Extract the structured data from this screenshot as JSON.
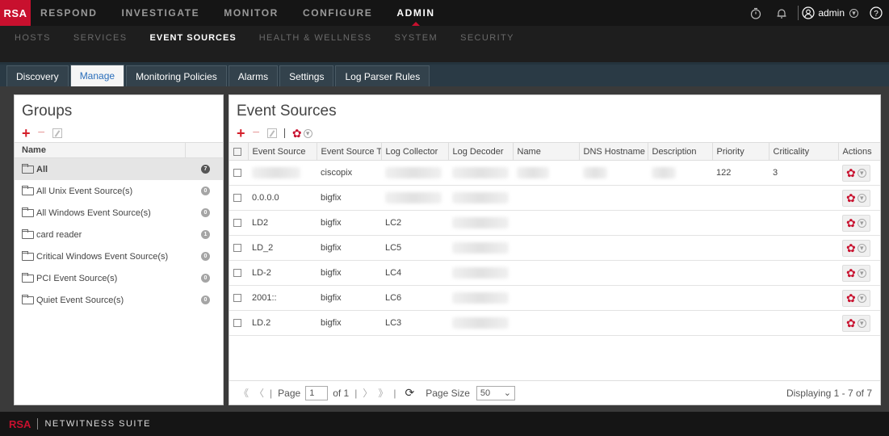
{
  "brand": {
    "logo": "RSA",
    "footer_logo": "RSA",
    "footer_suite": "NETWITNESS SUITE"
  },
  "topnav": {
    "items": [
      "RESPOND",
      "INVESTIGATE",
      "MONITOR",
      "CONFIGURE",
      "ADMIN"
    ],
    "user": "admin"
  },
  "subnav": {
    "items": [
      "HOSTS",
      "SERVICES",
      "EVENT SOURCES",
      "HEALTH & WELLNESS",
      "SYSTEM",
      "SECURITY"
    ]
  },
  "tabs": [
    "Discovery",
    "Manage",
    "Monitoring Policies",
    "Alarms",
    "Settings",
    "Log Parser Rules"
  ],
  "groups": {
    "title": "Groups",
    "column_name": "Name",
    "items": [
      {
        "label": "All",
        "count": "7"
      },
      {
        "label": "All Unix Event Source(s)",
        "count": "0"
      },
      {
        "label": "All Windows Event Source(s)",
        "count": "0"
      },
      {
        "label": "card reader",
        "count": "1"
      },
      {
        "label": "Critical Windows Event Source(s)",
        "count": "0"
      },
      {
        "label": "PCI Event Source(s)",
        "count": "0"
      },
      {
        "label": "Quiet Event Source(s)",
        "count": "0"
      }
    ]
  },
  "events": {
    "title": "Event Sources",
    "columns": [
      "Event Source",
      "Event Source Ty",
      "Log Collector",
      "Log Decoder",
      "Name",
      "DNS Hostname",
      "Description",
      "Priority",
      "Criticality",
      "Actions"
    ],
    "rows": [
      {
        "source": "",
        "type": "ciscopix",
        "collector": "",
        "decoder": "",
        "name": "",
        "dns": "",
        "desc": "",
        "priority": "122",
        "criticality": "3"
      },
      {
        "source": "0.0.0.0",
        "type": "bigfix",
        "collector": "",
        "decoder": "",
        "name": "",
        "dns": "",
        "desc": "",
        "priority": "",
        "criticality": ""
      },
      {
        "source": "LD2",
        "type": "bigfix",
        "collector": "LC2",
        "decoder": "",
        "name": "",
        "dns": "",
        "desc": "",
        "priority": "",
        "criticality": ""
      },
      {
        "source": "LD_2",
        "type": "bigfix",
        "collector": "LC5",
        "decoder": "",
        "name": "",
        "dns": "",
        "desc": "",
        "priority": "",
        "criticality": ""
      },
      {
        "source": "LD-2",
        "type": "bigfix",
        "collector": "LC4",
        "decoder": "",
        "name": "",
        "dns": "",
        "desc": "",
        "priority": "",
        "criticality": ""
      },
      {
        "source": "2001::",
        "type": "bigfix",
        "collector": "LC6",
        "decoder": "",
        "name": "",
        "dns": "",
        "desc": "",
        "priority": "",
        "criticality": ""
      },
      {
        "source": "LD.2",
        "type": "bigfix",
        "collector": "LC3",
        "decoder": "",
        "name": "",
        "dns": "",
        "desc": "",
        "priority": "",
        "criticality": ""
      }
    ]
  },
  "pager": {
    "page_label": "Page",
    "page_value": "1",
    "of_label": "of 1",
    "size_label": "Page Size",
    "size_value": "50",
    "display": "Displaying 1 - 7 of 7"
  }
}
